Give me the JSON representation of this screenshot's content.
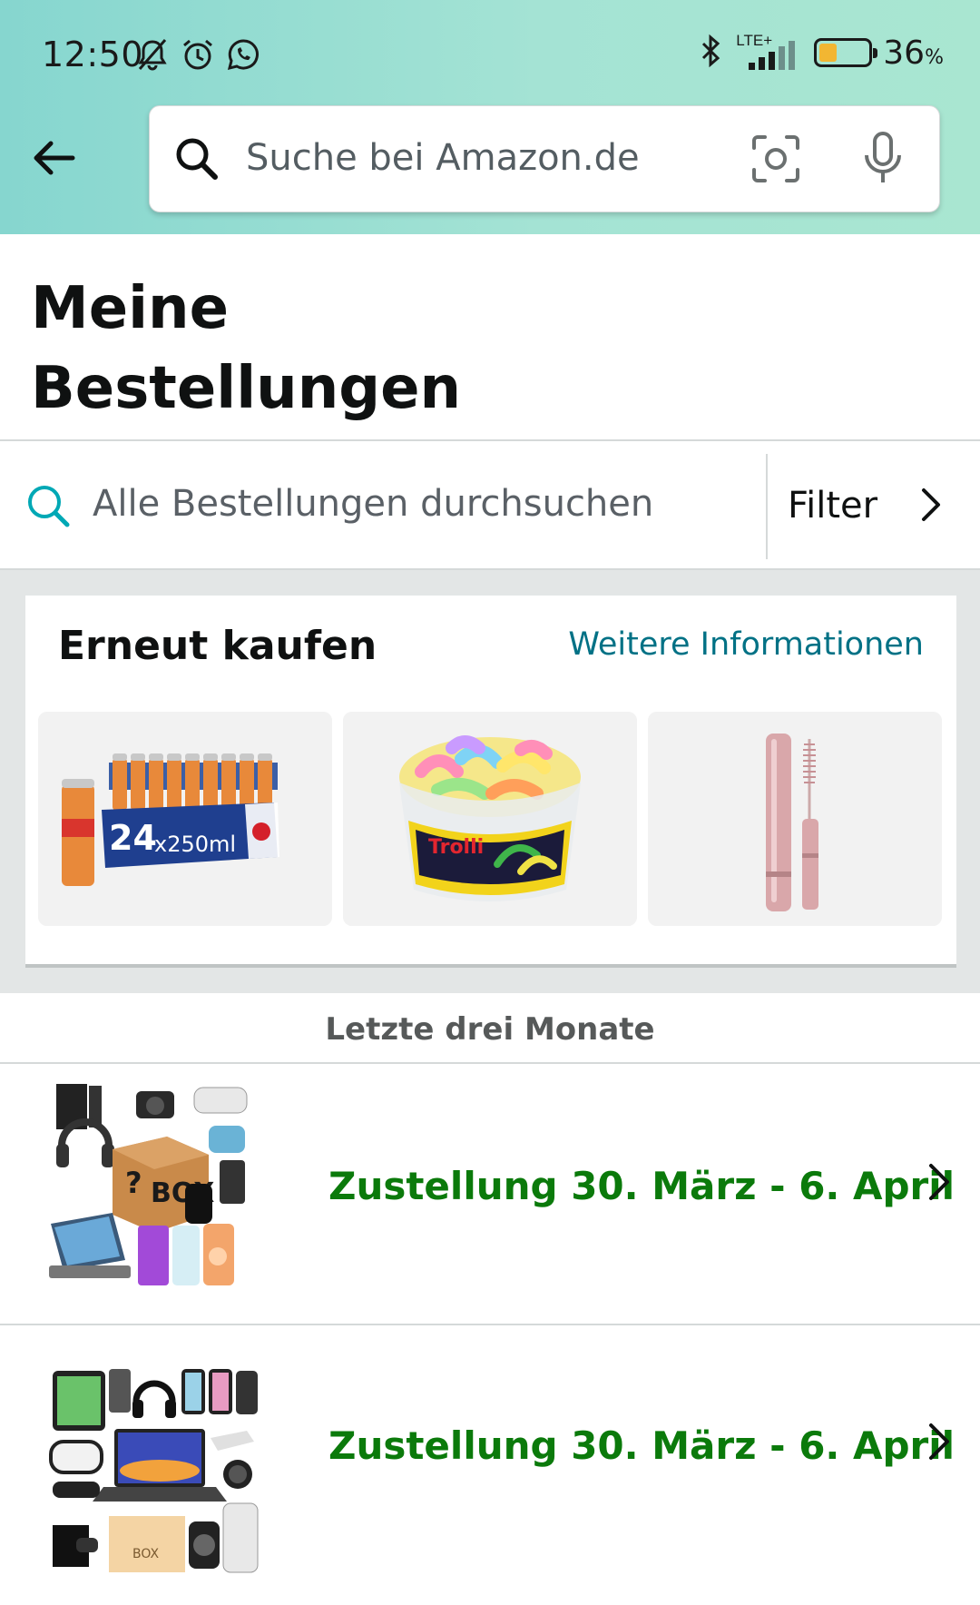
{
  "status_bar": {
    "time": "12:50",
    "network": "LTE+",
    "battery_percent_label": "36",
    "battery_percent_sign": "%",
    "battery_level": 0.36,
    "battery_color": "#f2b632"
  },
  "header": {
    "back_icon": "arrow-left-icon",
    "search_placeholder": "Suche bei Amazon.de",
    "search_icon": "search-icon",
    "camera_icon": "camera-scan-icon",
    "mic_icon": "microphone-icon"
  },
  "page": {
    "title_line1": "Meine",
    "title_line2": "Bestellungen"
  },
  "order_search": {
    "placeholder": "Alle Bestellungen durchsuchen",
    "filter_label": "Filter"
  },
  "buy_again": {
    "title": "Erneut kaufen",
    "more_link": "Weitere Informationen",
    "products": [
      {
        "name": "energy-drink-24-pack",
        "pack_label": "24",
        "size_label": "x250ml"
      },
      {
        "name": "sour-gummy-worms-tub",
        "brand_label": "Trolli"
      },
      {
        "name": "mascara"
      }
    ]
  },
  "orders": {
    "section_label": "Letzte drei Monate",
    "items": [
      {
        "status": "Zustellung 30. März - 6. April",
        "box_label": "BOX"
      },
      {
        "status": "Zustellung 30. März - 6. April",
        "box_label": "BOX"
      }
    ]
  },
  "colors": {
    "header_gradient": [
      "#86d6cf",
      "#a9e6d1"
    ],
    "link": "#007185",
    "delivery_green": "#0b7a0b",
    "search_accent": "#00a8b5"
  }
}
